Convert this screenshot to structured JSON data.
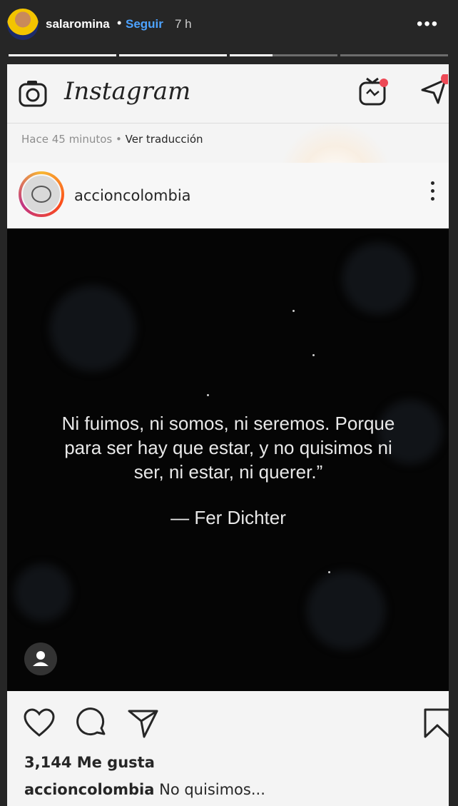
{
  "story": {
    "username": "salaromina",
    "separator": "•",
    "follow_label": "Seguir",
    "time": "7 h",
    "more_icon": "more-horizontal-icon",
    "progress": [
      1,
      1,
      0.4,
      0,
      0
    ]
  },
  "instagram": {
    "logo_text": "Instagram",
    "time_ago": "Hace 45 minutos",
    "time_separator": " • ",
    "translate_label": "Ver traducción",
    "post": {
      "username": "accioncolombia",
      "quote_lines": [
        "Ni fuimos, ni somos, ni seremos. Porque",
        "para ser hay que estar, y no quisimos ni",
        "ser, ni estar, ni querer.”"
      ],
      "author": "— Fer Dichter",
      "likes": "3,144 Me gusta",
      "caption_user": "accioncolombia",
      "caption_text": " No quisimos..."
    }
  },
  "colors": {
    "story_bg": "#262626",
    "follow": "#4da3ff",
    "post_bg": "#050505"
  }
}
